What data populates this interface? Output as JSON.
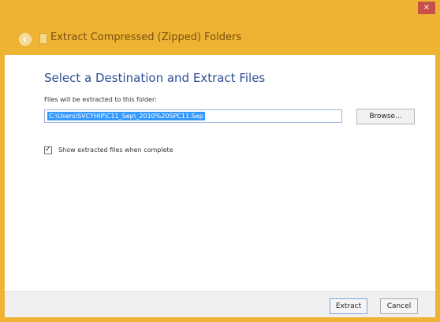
{
  "window": {
    "close_label": "×",
    "accent_color": "#efb333"
  },
  "wizard": {
    "title": "Extract Compressed (Zipped) Folders",
    "back_icon": "back-arrow-icon",
    "title_icon": "zip-folder-icon"
  },
  "main": {
    "heading": "Select a Destination and Extract Files",
    "destination_label": "Files will be extracted to this folder:",
    "destination_value": "C:\\Users\\SVCYHIP\\C11_Sep\\_2010%20SPC11.Sep",
    "browse_label": "Browse...",
    "show_files_label": "Show extracted files when complete",
    "show_files_checked": true,
    "check_glyph": "✓"
  },
  "footer": {
    "extract_label": "Extract",
    "cancel_label": "Cancel"
  }
}
